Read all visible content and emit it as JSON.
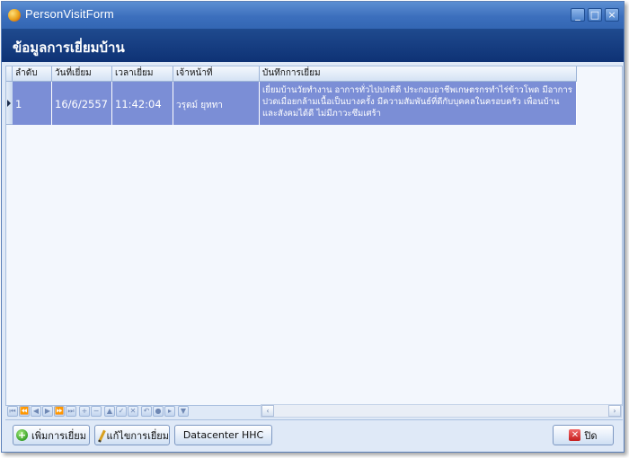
{
  "window": {
    "title": "PersonVisitForm",
    "controls": {
      "minimize": "_",
      "maximize": "□",
      "close": "×"
    }
  },
  "header": {
    "title": "ข้อมูลการเยี่ยมบ้าน"
  },
  "grid": {
    "columns": [
      "ลำดับ",
      "วันที่เยี่ยม",
      "เวลาเยี่ยม",
      "เจ้าหน้าที่",
      "บันทึกการเยี่ยม"
    ],
    "rows": [
      {
        "order": "1",
        "date": "16/6/2557",
        "time": "11:42:04",
        "staff": "วรุตม์ ยุททา",
        "note": "เยี่ยมบ้านวัยทำงาน อาการทั่วไปปกติดี ประกอบอาชีพเกษตรกรทำไร่ข้าวโพด มีอาการปวดเมื่อยกล้ามเนื้อเป็นบางครั้ง  มีความสัมพันธ์ที่ดีกับบุคคลในครอบครัว เพื่อนบ้าน และสังคมได้ดี ไม่มีภาวะซึมเศร้า"
      }
    ]
  },
  "navigator": {
    "buttons": [
      "⏮",
      "⏪",
      "◀",
      "▶",
      "⏩",
      "⏭",
      "+",
      "−",
      "▲",
      "✓",
      "✕",
      "↶",
      "●",
      "▸",
      "▼"
    ]
  },
  "scrollbar": {
    "left": "‹",
    "right": "›"
  },
  "buttons": {
    "add": "เพิ่มการเยี่ยม",
    "edit": "แก้ไขการเยี่ยม",
    "datacenter": "Datacenter HHC",
    "close": "ปิด"
  },
  "colors": {
    "title_bar": "#3c6fbd",
    "header_band": "#1a4287",
    "selected_row": "#7b8ed6",
    "background": "#dfe9f7"
  }
}
